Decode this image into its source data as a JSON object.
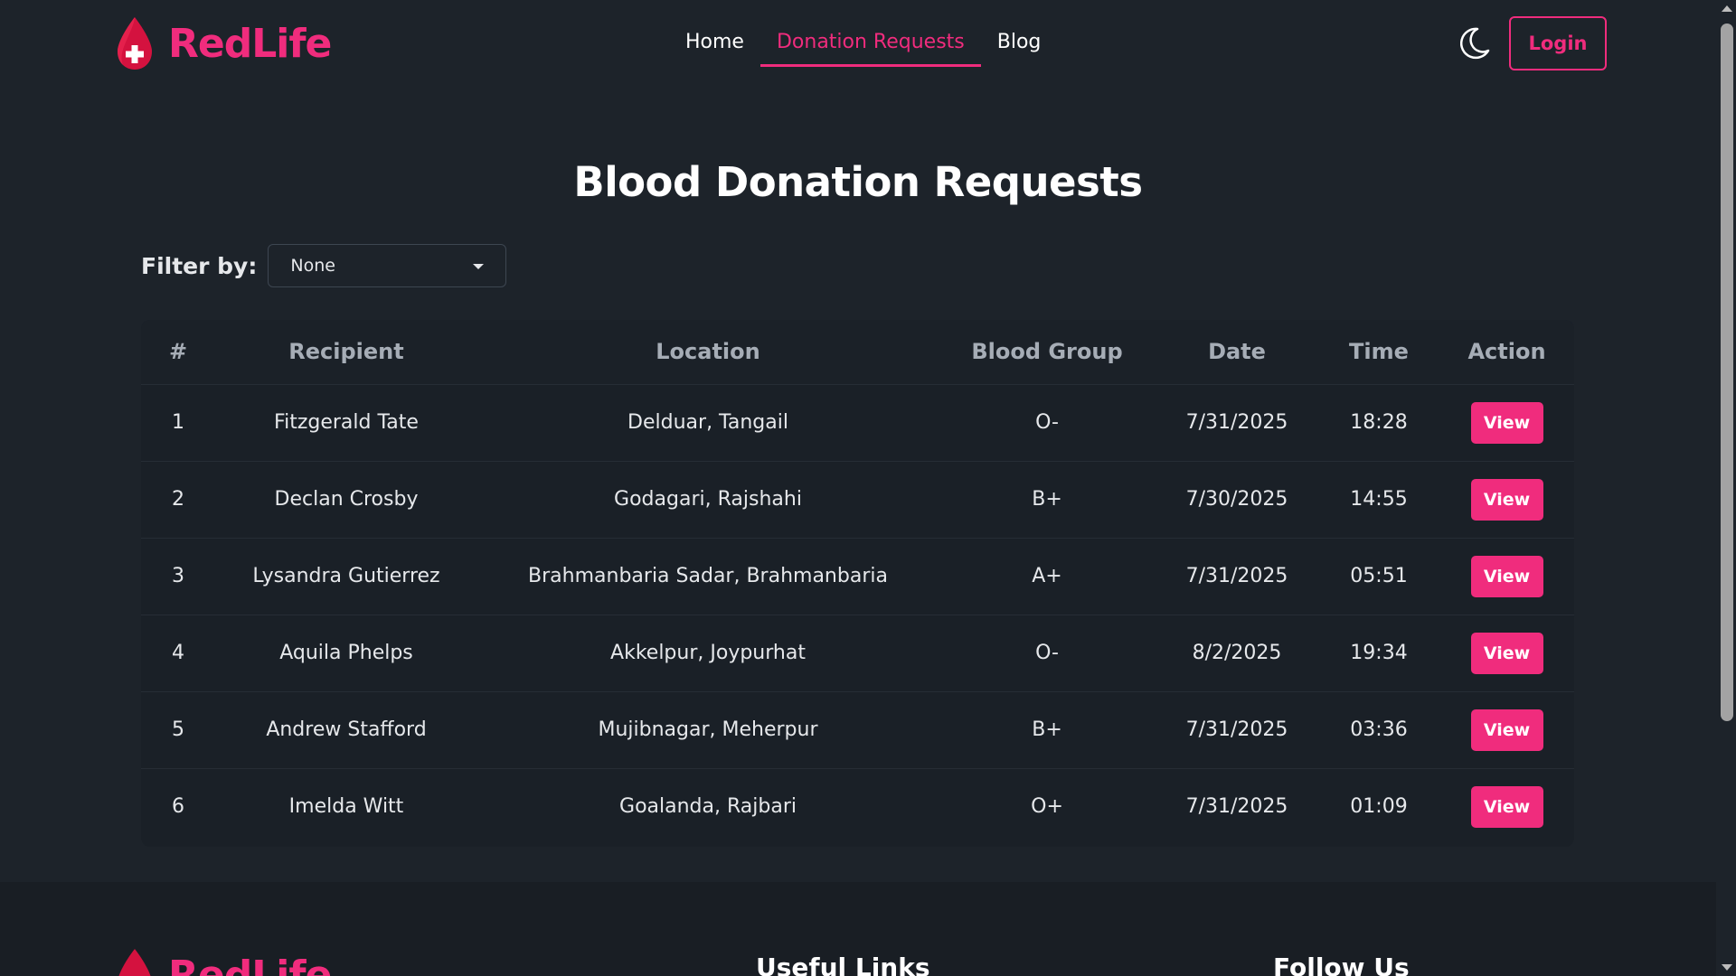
{
  "brand": {
    "name": "RedLife",
    "icon": "blood-drop-cross-icon",
    "color": "#f02c7d"
  },
  "nav": {
    "items": [
      {
        "label": "Home",
        "active": false
      },
      {
        "label": "Donation Requests",
        "active": true
      },
      {
        "label": "Blog",
        "active": false
      }
    ],
    "theme_icon": "moon-icon",
    "login_label": "Login"
  },
  "page": {
    "title": "Blood Donation Requests"
  },
  "filter": {
    "label": "Filter by:",
    "value": "None"
  },
  "table": {
    "columns": [
      "#",
      "Recipient",
      "Location",
      "Blood Group",
      "Date",
      "Time",
      "Action"
    ],
    "rows": [
      {
        "num": "1",
        "recipient": "Fitzgerald Tate",
        "location": "Delduar, Tangail",
        "blood_group": "O-",
        "date": "7/31/2025",
        "time": "18:28",
        "action": "View"
      },
      {
        "num": "2",
        "recipient": "Declan Crosby",
        "location": "Godagari, Rajshahi",
        "blood_group": "B+",
        "date": "7/30/2025",
        "time": "14:55",
        "action": "View"
      },
      {
        "num": "3",
        "recipient": "Lysandra Gutierrez",
        "location": "Brahmanbaria Sadar, Brahmanbaria",
        "blood_group": "A+",
        "date": "7/31/2025",
        "time": "05:51",
        "action": "View"
      },
      {
        "num": "4",
        "recipient": "Aquila Phelps",
        "location": "Akkelpur, Joypurhat",
        "blood_group": "O-",
        "date": "8/2/2025",
        "time": "19:34",
        "action": "View"
      },
      {
        "num": "5",
        "recipient": "Andrew Stafford",
        "location": "Mujibnagar, Meherpur",
        "blood_group": "B+",
        "date": "7/31/2025",
        "time": "03:36",
        "action": "View"
      },
      {
        "num": "6",
        "recipient": "Imelda Witt",
        "location": "Goalanda, Rajbari",
        "blood_group": "O+",
        "date": "7/31/2025",
        "time": "01:09",
        "action": "View"
      }
    ]
  },
  "footer": {
    "brand": "RedLife",
    "useful_links_heading": "Useful Links",
    "follow_us_heading": "Follow Us"
  }
}
